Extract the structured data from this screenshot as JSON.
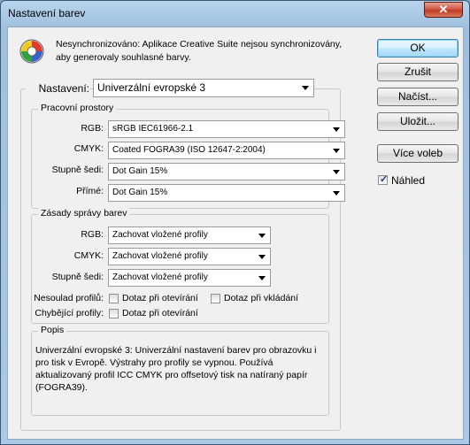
{
  "window": {
    "title": "Nastavení barev",
    "close_label": "✕"
  },
  "header": {
    "icon": "color-wheel-icon",
    "message": "Nesynchronizováno: Aplikace Creative Suite nejsou synchronizovány, aby generovaly souhlasné barvy."
  },
  "buttons": {
    "ok": "OK",
    "cancel": "Zrušit",
    "load": "Načíst...",
    "save": "Uložit...",
    "more": "Více voleb"
  },
  "preview": {
    "label": "Náhled",
    "checked": true
  },
  "settings": {
    "label": "Nastavení:",
    "value": "Univerzální evropské 3"
  },
  "working_spaces": {
    "title": "Pracovní prostory",
    "rgb_label": "RGB:",
    "rgb_value": "sRGB IEC61966-2.1",
    "cmyk_label": "CMYK:",
    "cmyk_value": "Coated FOGRA39 (ISO 12647-2:2004)",
    "gray_label": "Stupně šedi:",
    "gray_value": "Dot Gain 15%",
    "spot_label": "Přímé:",
    "spot_value": "Dot Gain 15%"
  },
  "policies": {
    "title": "Zásady správy barev",
    "rgb_label": "RGB:",
    "rgb_value": "Zachovat vložené profily",
    "cmyk_label": "CMYK:",
    "cmyk_value": "Zachovat vložené profily",
    "gray_label": "Stupně šedi:",
    "gray_value": "Zachovat vložené profily",
    "mismatch_label": "Nesoulad profilů:",
    "ask_open": "Dotaz při otevírání",
    "ask_paste": "Dotaz při vkládání",
    "missing_label": "Chybějící profily:",
    "missing_ask_open": "Dotaz při otevírání"
  },
  "description": {
    "title": "Popis",
    "text": "Univerzální evropské 3:  Univerzální nastavení barev pro obrazovku i pro tisk v Evropě. Výstrahy pro profily se vypnou. Používá aktualizovaný profil ICC CMYK pro offsetový tisk na natíraný papír (FOGRA39)."
  },
  "colors": {
    "titlebar": "#a9c9e6",
    "close": "#c13a22",
    "dialog": "#f0f0f0",
    "default_button": "#bee6fd"
  }
}
